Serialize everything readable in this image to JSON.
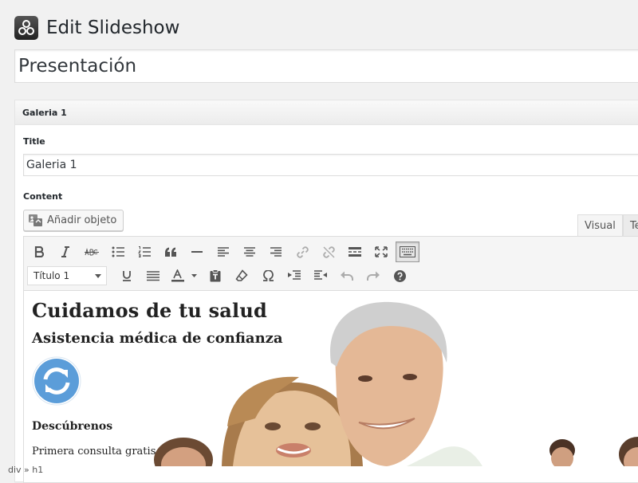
{
  "header": {
    "title": "Edit Slideshow"
  },
  "slideshow": {
    "name": "Presentación"
  },
  "slide_box": {
    "heading": "Galeria 1",
    "title_label": "Title",
    "title_value": "Galeria 1",
    "content_label": "Content",
    "add_media_label": "Añadir objeto"
  },
  "editor": {
    "tabs": {
      "visual": "Visual",
      "text": "Te"
    },
    "format_select": "Título 1",
    "content": {
      "h1": "Cuidamos de tu salud",
      "h2": "Asistencia médica de confianza",
      "h3": "Descúbrenos",
      "paragraph": "Primera consulta gratis"
    },
    "path": "div » h1"
  },
  "colors": {
    "accent_blue": "#5b9dd9",
    "page_bg": "#f1f1f1"
  }
}
